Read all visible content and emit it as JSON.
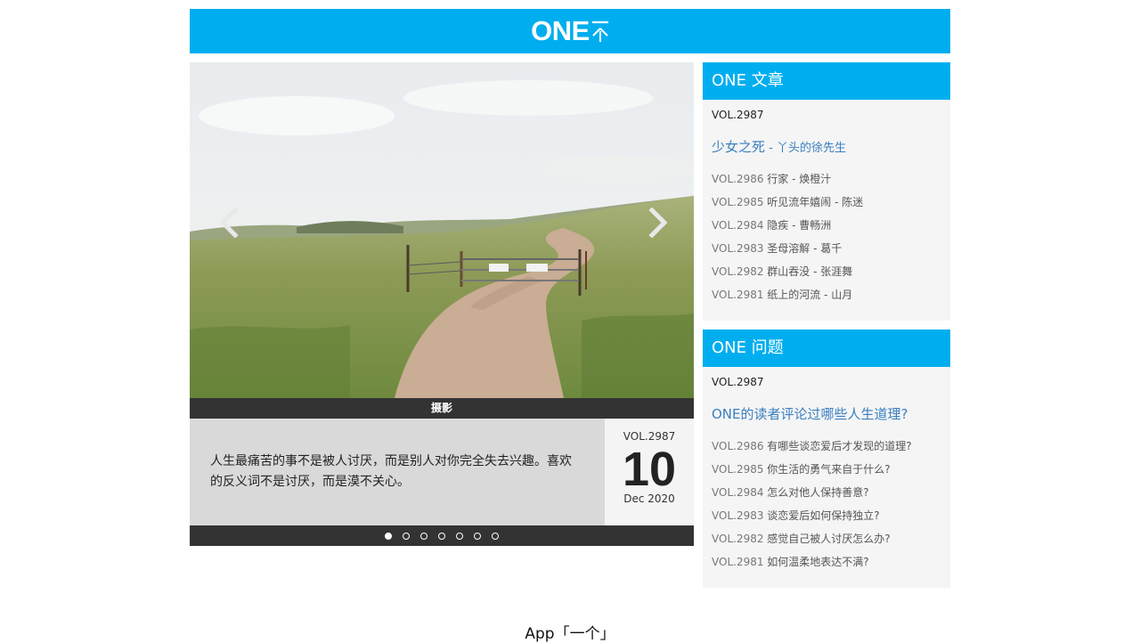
{
  "header": {
    "logo_text": "ONE",
    "logo_cn": "一个",
    "bg_color": "#00aeef"
  },
  "carousel": {
    "caption": "摄影",
    "quote": "人生最痛苦的事不是被人讨厌，而是别人对你完全失去兴趣。喜欢的反义词不是讨厌，而是漠不关心。",
    "date": {
      "vol": "VOL.2987",
      "day": "10",
      "month_year": "Dec 2020"
    },
    "slide_count": 7,
    "active_slide": 0,
    "prev_icon": "chevron-left-icon",
    "next_icon": "chevron-right-icon"
  },
  "articles": {
    "title": "ONE 文章",
    "current_vol": "VOL.2987",
    "featured_title": "少女之死",
    "featured_author": " - 丫头的徐先生",
    "items": [
      {
        "vol": "VOL.2986",
        "text": " 行家 - 焕橙汁"
      },
      {
        "vol": "VOL.2985",
        "text": " 听见流年嬉闹 - 陈迷"
      },
      {
        "vol": "VOL.2984",
        "text": " 隐疾 - 曹畅洲"
      },
      {
        "vol": "VOL.2983",
        "text": " 圣母溶解 - 葛千"
      },
      {
        "vol": "VOL.2982",
        "text": " 群山吞没 - 张涯舞"
      },
      {
        "vol": "VOL.2981",
        "text": " 纸上的河流 - 山月"
      }
    ]
  },
  "questions": {
    "title": "ONE 问题",
    "current_vol": "VOL.2987",
    "featured_title": "ONE的读者评论过哪些人生道理?",
    "items": [
      {
        "vol": "VOL.2986",
        "text": " 有哪些谈恋爱后才发现的道理?"
      },
      {
        "vol": "VOL.2985",
        "text": " 你生活的勇气来自于什么?"
      },
      {
        "vol": "VOL.2984",
        "text": " 怎么对他人保持善意?"
      },
      {
        "vol": "VOL.2983",
        "text": " 谈恋爱后如何保持独立?"
      },
      {
        "vol": "VOL.2982",
        "text": " 感觉自己被人讨厌怎么办?"
      },
      {
        "vol": "VOL.2981",
        "text": " 如何温柔地表达不满?"
      }
    ]
  },
  "footer": {
    "text": "App「一个」"
  }
}
